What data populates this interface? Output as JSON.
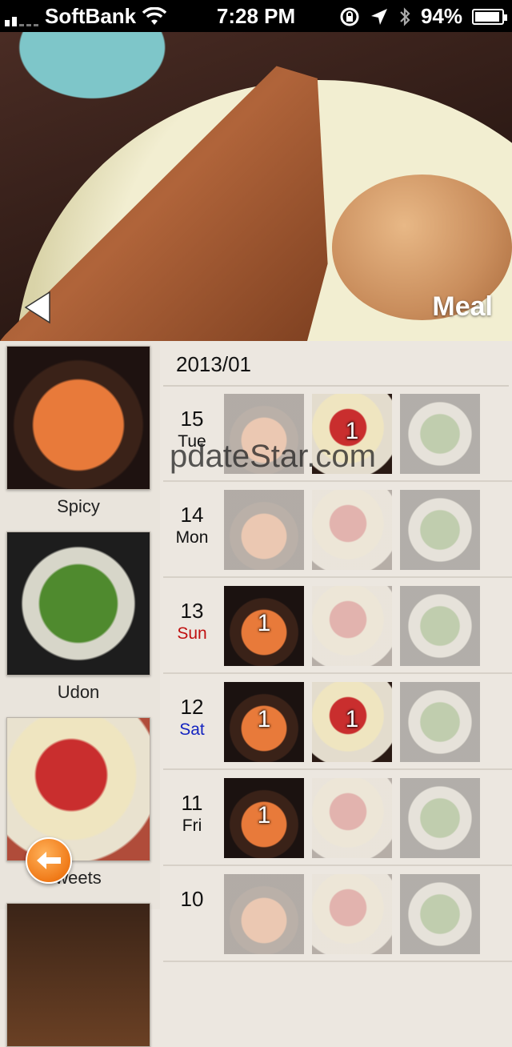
{
  "status_bar": {
    "carrier": "SoftBank",
    "time": "7:28 PM",
    "battery": "94%",
    "battery_level": 0.94
  },
  "header": {
    "title": "Meal"
  },
  "categories": [
    {
      "label": "Spicy"
    },
    {
      "label": "Udon"
    },
    {
      "label": "weets"
    }
  ],
  "month": "2013/01",
  "days": [
    {
      "day": "15",
      "weekday": "Tue",
      "cells": [
        {
          "type": "ramen",
          "count": ""
        },
        {
          "type": "sweets",
          "count": "1"
        },
        {
          "type": "udon",
          "count": ""
        }
      ]
    },
    {
      "day": "14",
      "weekday": "Mon",
      "cells": [
        {
          "type": "ramen",
          "count": ""
        },
        {
          "type": "sweets",
          "count": ""
        },
        {
          "type": "udon",
          "count": ""
        }
      ]
    },
    {
      "day": "13",
      "weekday": "Sun",
      "cells": [
        {
          "type": "ramen",
          "count": "1"
        },
        {
          "type": "sweets",
          "count": ""
        },
        {
          "type": "udon",
          "count": ""
        }
      ]
    },
    {
      "day": "12",
      "weekday": "Sat",
      "cells": [
        {
          "type": "ramen",
          "count": "1"
        },
        {
          "type": "sweets",
          "count": "1"
        },
        {
          "type": "udon",
          "count": ""
        }
      ]
    },
    {
      "day": "11",
      "weekday": "Fri",
      "cells": [
        {
          "type": "ramen",
          "count": "1"
        },
        {
          "type": "sweets",
          "count": ""
        },
        {
          "type": "udon",
          "count": ""
        }
      ]
    },
    {
      "day": "10",
      "weekday": "",
      "cells": [
        {
          "type": "ramen",
          "count": ""
        },
        {
          "type": "sweets",
          "count": ""
        },
        {
          "type": "udon",
          "count": ""
        }
      ]
    }
  ],
  "watermark": "pdateStar.com",
  "icons": {
    "back": "back-triangle-icon",
    "fab": "arrow-left-icon"
  },
  "colors": {
    "sunday": "#c01010",
    "saturday": "#1424c0",
    "fab": "#f07a18"
  }
}
